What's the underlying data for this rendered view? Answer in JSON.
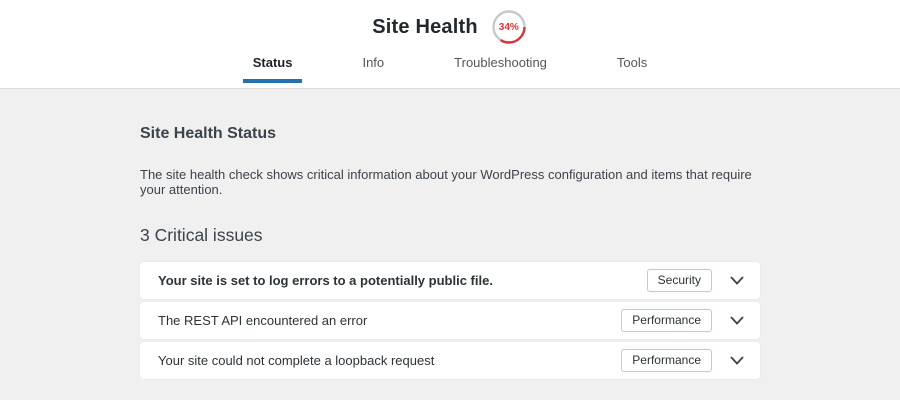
{
  "header": {
    "title": "Site Health",
    "progress": {
      "percent": 34,
      "label": "34%"
    },
    "tabs": [
      {
        "label": "Status",
        "active": true
      },
      {
        "label": "Info",
        "active": false
      },
      {
        "label": "Troubleshooting",
        "active": false
      },
      {
        "label": "Tools",
        "active": false
      }
    ]
  },
  "main": {
    "section_title": "Site Health Status",
    "description": "The site health check shows critical information about your WordPress configuration and items that require your attention.",
    "issues_heading": "3 Critical issues",
    "issues": [
      {
        "label": "Your site is set to log errors to a potentially public file.",
        "badge": "Security"
      },
      {
        "label": "The REST API encountered an error",
        "badge": "Performance"
      },
      {
        "label": "Your site could not complete a loopback request",
        "badge": "Performance"
      }
    ]
  },
  "colors": {
    "accent_blue": "#2271b1",
    "alert_red": "#d63638",
    "ring_gray": "#c6c8ca",
    "badge_border": "#a8d4e5",
    "background": "#f0f0f1"
  }
}
